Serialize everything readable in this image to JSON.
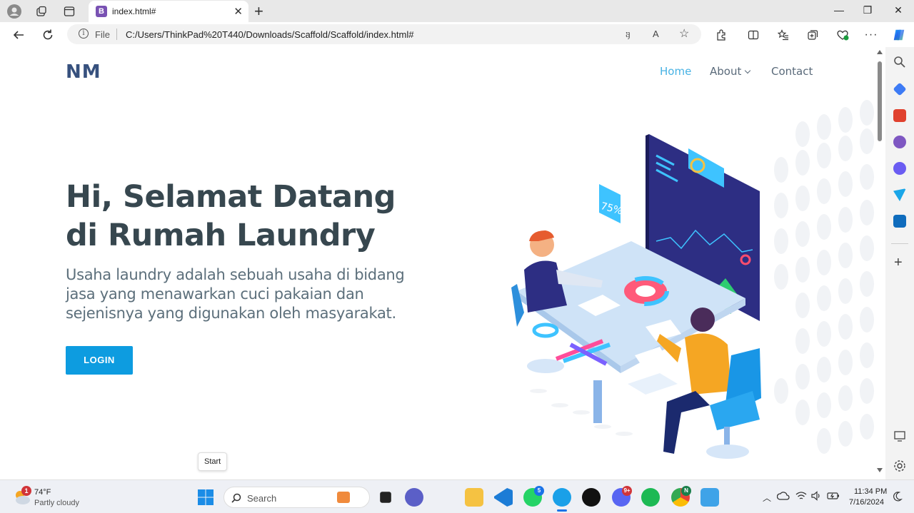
{
  "browser": {
    "tab_title": "index.html#",
    "tab_favicon": "B",
    "address_label": "File",
    "url": "C:/Users/ThinkPad%20T440/Downloads/Scaffold/Scaffold/index.html#",
    "read_aloud": "A",
    "translate": "a"
  },
  "page": {
    "logo": "NM",
    "nav": {
      "home": "Home",
      "about": "About",
      "contact": "Contact"
    },
    "hero_title": "Hi, Selamat Datang di Rumah Laundry",
    "hero_subtitle": "Usaha laundry adalah sebuah usaha di bidang jasa yang menawarkan cuci pakaian dan sejenisnya yang digunakan oleh masyarakat.",
    "login_button": "LOGIN",
    "illustration_label": "75%"
  },
  "tooltip": "Start",
  "taskbar": {
    "weather_temp": "74°F",
    "weather_desc": "Partly cloudy",
    "weather_badge": "1",
    "search_placeholder": "Search",
    "whatsapp_badge": "5",
    "discord_badge": "9+",
    "chrome_badge": "N",
    "time": "11:34 PM",
    "date": "7/16/2024"
  },
  "colors": {
    "accent": "#47b2e4",
    "button": "#0d9ce0",
    "heading": "#37474f",
    "logo": "#37517e"
  }
}
